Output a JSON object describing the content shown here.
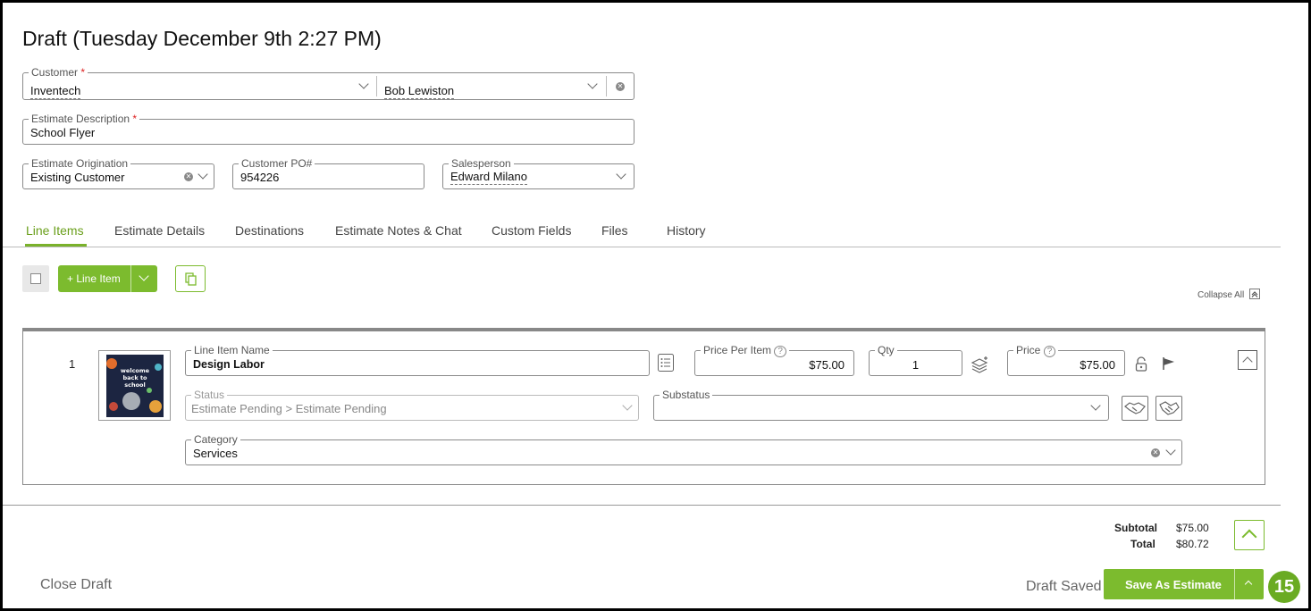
{
  "page": {
    "title": "Draft (Tuesday December 9th 2:27 PM)"
  },
  "customer": {
    "label": "Customer",
    "required_mark": "*",
    "company": "Inventech",
    "contact": "Bob Lewiston"
  },
  "estimate_description": {
    "label": "Estimate Description",
    "required_mark": "*",
    "value": "School Flyer"
  },
  "estimate_origination": {
    "label": "Estimate Origination",
    "value": "Existing Customer"
  },
  "customer_po": {
    "label": "Customer PO#",
    "value": "954226"
  },
  "salesperson": {
    "label": "Salesperson",
    "value": "Edward Milano"
  },
  "tabs": [
    {
      "label": "Line Items",
      "active": true
    },
    {
      "label": "Estimate Details"
    },
    {
      "label": "Destinations"
    },
    {
      "label": "Estimate Notes & Chat"
    },
    {
      "label": "Custom Fields"
    },
    {
      "label": "Files"
    },
    {
      "label": "History"
    }
  ],
  "toolbar": {
    "add_line_item_label": "+ Line Item",
    "collapse_all_label": "Collapse All"
  },
  "line_item": {
    "number": "1",
    "thumbnail_text": "welcome back to school",
    "name": {
      "label": "Line Item Name",
      "value": "Design Labor"
    },
    "price_per_item": {
      "label": "Price Per Item",
      "value": "$75.00"
    },
    "qty": {
      "label": "Qty",
      "value": "1"
    },
    "price": {
      "label": "Price",
      "value": "$75.00"
    },
    "status": {
      "label": "Status",
      "value": "Estimate Pending > Estimate Pending"
    },
    "substatus": {
      "label": "Substatus",
      "value": ""
    },
    "category": {
      "label": "Category",
      "value": "Services"
    }
  },
  "totals": {
    "subtotal_label": "Subtotal",
    "subtotal_value": "$75.00",
    "total_label": "Total",
    "total_value": "$80.72"
  },
  "footer": {
    "close_draft_label": "Close Draft",
    "draft_saved_label": "Draft Saved",
    "save_as_estimate_label": "Save As Estimate",
    "badge_count": "15"
  },
  "colors": {
    "accent": "#7cbb2e",
    "tab_active": "#6a9f1b",
    "required": "#dd2222"
  }
}
